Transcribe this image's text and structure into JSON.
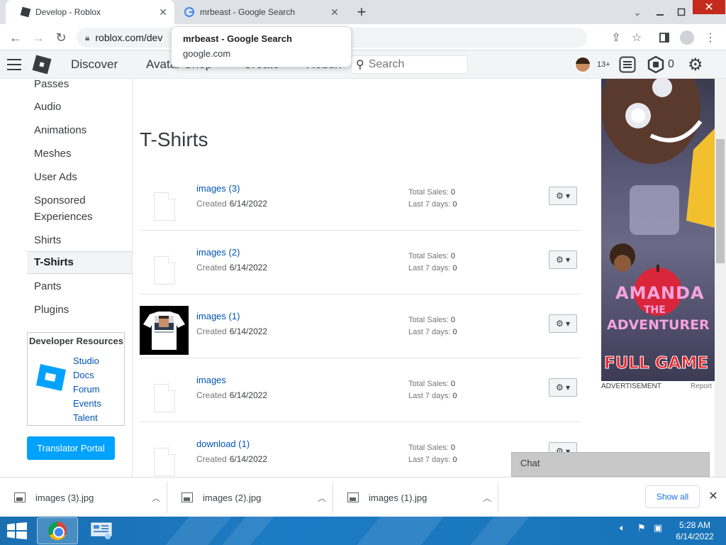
{
  "browser": {
    "tabs": [
      {
        "title": "Develop - Roblox",
        "close": "✕",
        "active": true
      },
      {
        "title": "mrbeast - Google Search",
        "close": "✕",
        "active": false
      }
    ],
    "new_tab": "+",
    "url": "roblox.com/dev",
    "tooltip": {
      "title": "mrbeast - Google Search",
      "domain": "google.com"
    },
    "window_close": "✕"
  },
  "roblox_nav": {
    "links": [
      "Discover",
      "Avatar Shop",
      "Create",
      "Robux"
    ],
    "search_placeholder": "Search",
    "age_badge": "13+",
    "robux_count": "0"
  },
  "left_menu": {
    "items": [
      {
        "label": "Passes",
        "selected": false
      },
      {
        "label": "Audio",
        "selected": false
      },
      {
        "label": "Animations",
        "selected": false
      },
      {
        "label": "Meshes",
        "selected": false
      },
      {
        "label": "User Ads",
        "selected": false
      },
      {
        "label": "Sponsored\nExperiences",
        "selected": false
      },
      {
        "label": "Shirts",
        "selected": false
      },
      {
        "label": "T-Shirts",
        "selected": true
      },
      {
        "label": "Pants",
        "selected": false
      },
      {
        "label": "Plugins",
        "selected": false
      }
    ],
    "dev_resources": {
      "heading": "Developer Resources",
      "links": [
        "Studio",
        "Docs",
        "Forum",
        "Events",
        "Talent"
      ]
    },
    "translator_button": "Translator Portal"
  },
  "main": {
    "title": "T-Shirts",
    "created_label": "Created",
    "total_sales_label": "Total Sales:",
    "last7_label": "Last 7 days:",
    "items": [
      {
        "name": "images (3)",
        "created": "6/14/2022",
        "total_sales": "0",
        "last_7_days": "0",
        "has_thumbnail": false
      },
      {
        "name": "images (2)",
        "created": "6/14/2022",
        "total_sales": "0",
        "last_7_days": "0",
        "has_thumbnail": false
      },
      {
        "name": "images (1)",
        "created": "6/14/2022",
        "total_sales": "0",
        "last_7_days": "0",
        "has_thumbnail": true
      },
      {
        "name": "images",
        "created": "6/14/2022",
        "total_sales": "0",
        "last_7_days": "0",
        "has_thumbnail": false
      },
      {
        "name": "download (1)",
        "created": "6/14/2022",
        "total_sales": "0",
        "last_7_days": "0",
        "has_thumbnail": false
      }
    ],
    "gear_label": "⚙ ▾"
  },
  "ad": {
    "label": "ADVERTISEMENT",
    "report": "Report",
    "lines": [
      "AMANDA",
      "THE",
      "ADVENTURER",
      "FULL GAME"
    ]
  },
  "chat": {
    "label": "Chat"
  },
  "downloads": {
    "files": [
      {
        "name": "images (3).jpg"
      },
      {
        "name": "images (2).jpg"
      },
      {
        "name": "images (1).jpg"
      }
    ],
    "show_all": "Show all",
    "close": "✕"
  },
  "taskbar": {
    "time": "5:28 AM",
    "date": "6/14/2022"
  },
  "colors": {
    "accent_blue": "#00a2ff",
    "link_blue": "#0055b3",
    "taskbar_blue": "#1c7bc4"
  }
}
